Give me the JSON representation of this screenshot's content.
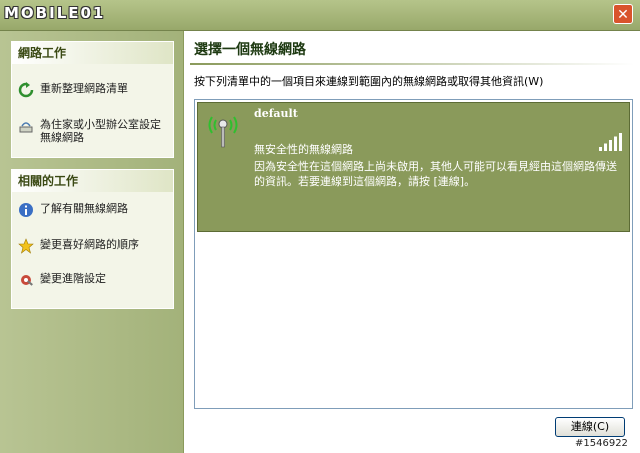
{
  "brand": {
    "logo_text": "MOBILE01"
  },
  "window": {
    "close_label": "✕"
  },
  "sidebar": {
    "network_tasks": {
      "title": "網路工作",
      "items": [
        {
          "label": "重新整理網路清單",
          "icon": "refresh-icon"
        },
        {
          "label": "為住家或小型辦公室設定無線網路",
          "icon": "network-setup-icon"
        }
      ]
    },
    "related_tasks": {
      "title": "相關的工作",
      "items": [
        {
          "label": "了解有關無線網路",
          "icon": "info-icon"
        },
        {
          "label": "變更喜好網路的順序",
          "icon": "star-icon"
        },
        {
          "label": "變更進階設定",
          "icon": "settings-icon"
        }
      ]
    }
  },
  "main": {
    "title": "選擇一個無線網路",
    "instruction": "按下列清單中的一個項目來連線到範圍內的無線網路或取得其他資訊(W)",
    "networks": [
      {
        "name": "default",
        "security": "無安全性的無線網路",
        "description": "因為安全性在這個網路上尚未啟用，其他人可能可以看見經由這個網路傳送的資訊。若要連線到這個網路，請按 [連線]。",
        "signal_bars": 5
      }
    ],
    "connect_label": "連線(C)"
  },
  "watermark": "#1546922",
  "colors": {
    "accent": "#8a9a5b",
    "panel_bg": "#f3f5e8"
  }
}
